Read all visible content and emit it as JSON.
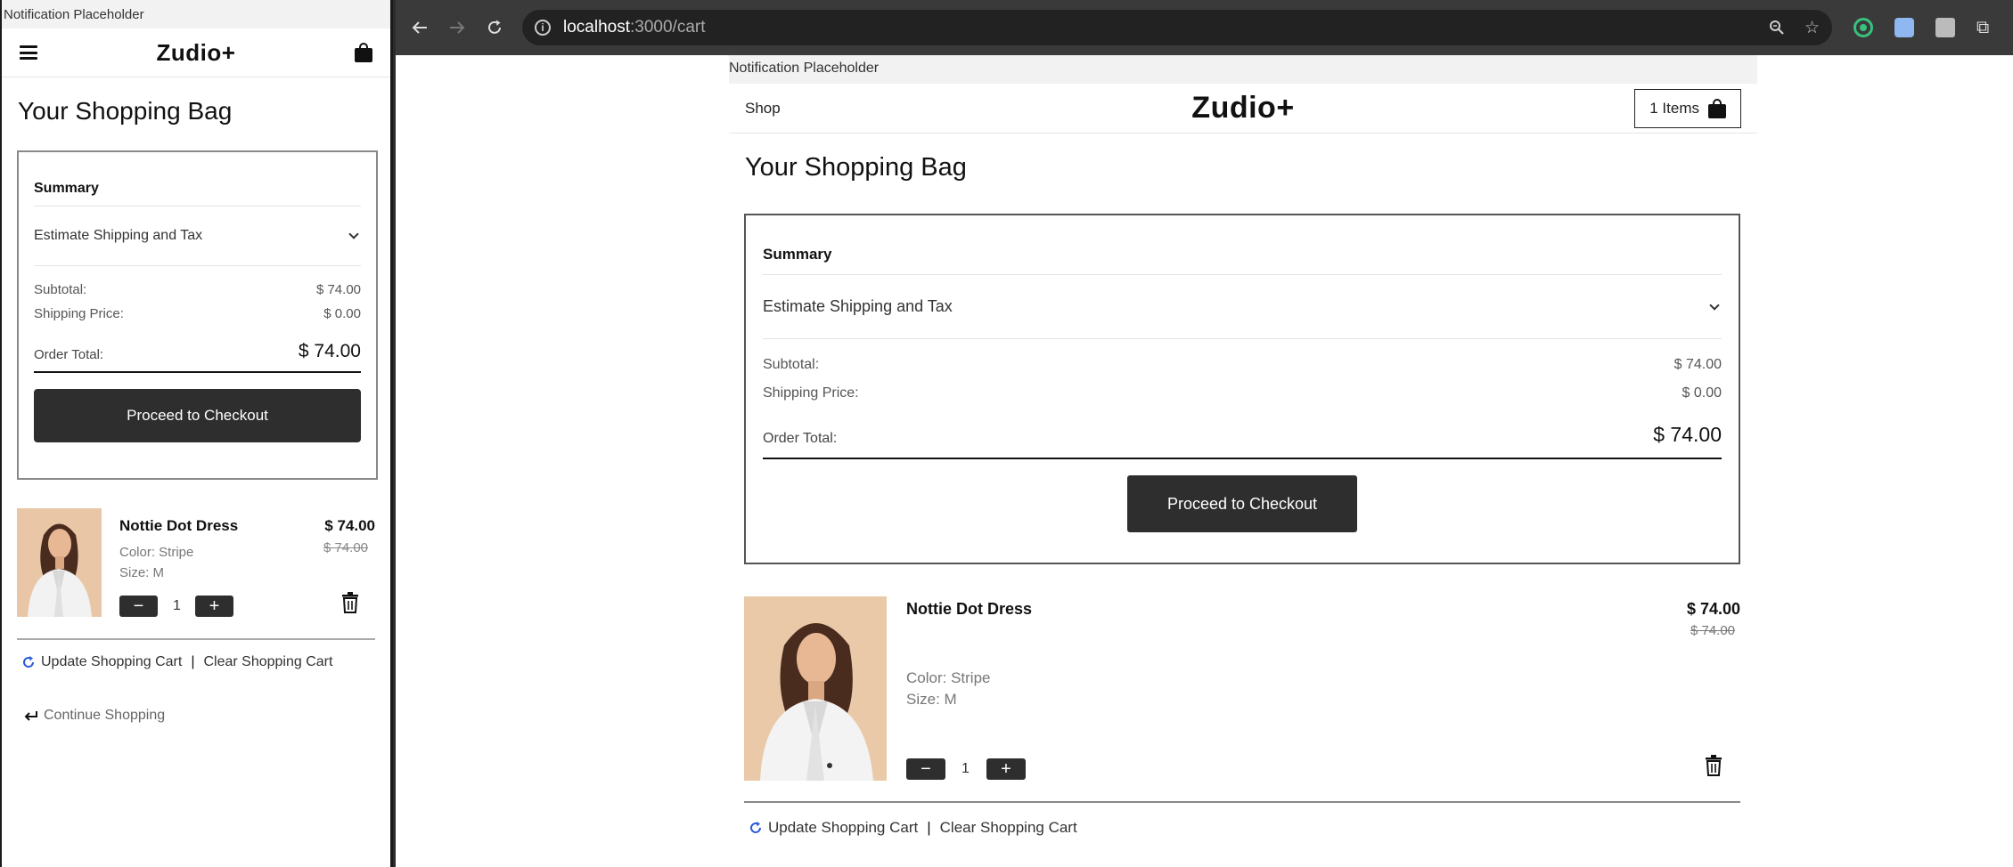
{
  "mobile": {
    "notification": "Notification Placeholder",
    "logo": "Zudio+",
    "title": "Your Shopping Bag",
    "summary": {
      "title": "Summary",
      "estimate_label": "Estimate Shipping and Tax",
      "subtotal_label": "Subtotal:",
      "subtotal_value": "$ 74.00",
      "shipping_label": "Shipping Price:",
      "shipping_value": "$ 0.00",
      "total_label": "Order Total:",
      "total_value": "$ 74.00",
      "checkout_label": "Proceed to Checkout"
    },
    "item": {
      "name": "Nottie Dot Dress",
      "price": "$ 74.00",
      "old_price": "$ 74.00",
      "color": "Color: Stripe",
      "size": "Size: M",
      "quantity": "1",
      "minus": "−",
      "plus": "+"
    },
    "update_label": "Update Shopping Cart",
    "separator": "|",
    "clear_label": "Clear Shopping Cart",
    "continue_label": "Continue Shopping"
  },
  "browser": {
    "url_host": "localhost",
    "url_path": ":3000/cart",
    "back_icon": "arrow-left-icon",
    "forward_icon": "arrow-right-icon",
    "reload_icon": "reload-icon"
  },
  "desktop": {
    "notification": "Notification Placeholder",
    "shop_label": "Shop",
    "logo": "Zudio+",
    "cart_count": "1 Items",
    "title": "Your Shopping Bag",
    "summary": {
      "title": "Summary",
      "estimate_label": "Estimate Shipping and Tax",
      "subtotal_label": "Subtotal:",
      "subtotal_value": "$ 74.00",
      "shipping_label": "Shipping Price:",
      "shipping_value": "$ 0.00",
      "total_label": "Order Total:",
      "total_value": "$ 74.00",
      "checkout_label": "Proceed to Checkout"
    },
    "item": {
      "name": "Nottie Dot Dress",
      "price": "$ 74.00",
      "old_price": "$ 74.00",
      "color": "Color: Stripe",
      "size": "Size: M",
      "quantity": "1",
      "minus": "−",
      "plus": "+"
    },
    "update_label": "Update Shopping Cart",
    "separator": "|",
    "clear_label": "Clear Shopping Cart"
  },
  "colors": {
    "button_dark": "#2e2e2e",
    "refresh_blue": "#2a5bd7",
    "chrome_bar": "#3a3a3a"
  }
}
